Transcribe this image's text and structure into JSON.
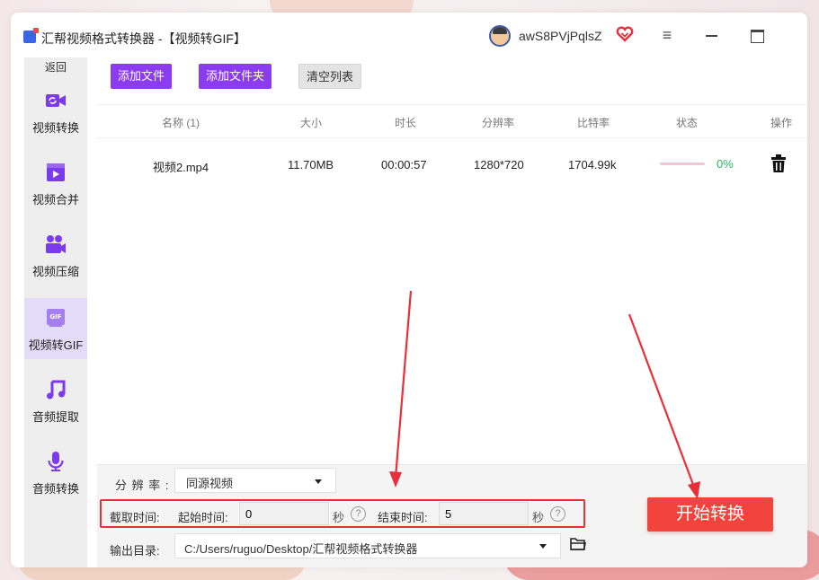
{
  "app": {
    "title": "汇帮视频格式转换器  -【视频转GIF】",
    "username": "awS8PVjPqlsZ"
  },
  "sidebar": {
    "back_label": "返回",
    "items": [
      {
        "label": "视频转换",
        "icon": "video-convert-icon"
      },
      {
        "label": "视频合并",
        "icon": "video-merge-icon"
      },
      {
        "label": "视频压缩",
        "icon": "video-compress-icon"
      },
      {
        "label": "视频转GIF",
        "icon": "gif-icon",
        "active": true
      },
      {
        "label": "音频提取",
        "icon": "music-note-icon"
      },
      {
        "label": "音频转换",
        "icon": "microphone-icon"
      }
    ]
  },
  "toolbar": {
    "add_file": "添加文件",
    "add_folder": "添加文件夹",
    "clear_list": "清空列表"
  },
  "table": {
    "columns": [
      "名称 (1)",
      "大小",
      "时长",
      "分辨率",
      "比特率",
      "状态",
      "操作"
    ],
    "rows": [
      {
        "name": "视频2.mp4",
        "size": "11.70MB",
        "duration": "00:00:57",
        "resolution": "1280*720",
        "bitrate": "1704.99k",
        "progress": "0%",
        "progress_value": 0
      }
    ]
  },
  "settings": {
    "resolution_label": "分 辨 率 :",
    "resolution_value": "同源视频",
    "clip_label": "截取时间:",
    "start_time_label": "起始时间:",
    "start_time_value": "0",
    "end_time_label": "结束时间:",
    "end_time_value": "5",
    "sec_unit": "秒",
    "help_glyph": "?",
    "output_label": "输出目录:",
    "output_path": "C:/Users/ruguo/Desktop/汇帮视频格式转换器"
  },
  "actions": {
    "start_label": "开始转换"
  },
  "colors": {
    "accent_purple": "#8c3cf0",
    "start_red": "#f2443d",
    "annotation_red": "#e8303a",
    "progress_green": "#2bb75c"
  }
}
